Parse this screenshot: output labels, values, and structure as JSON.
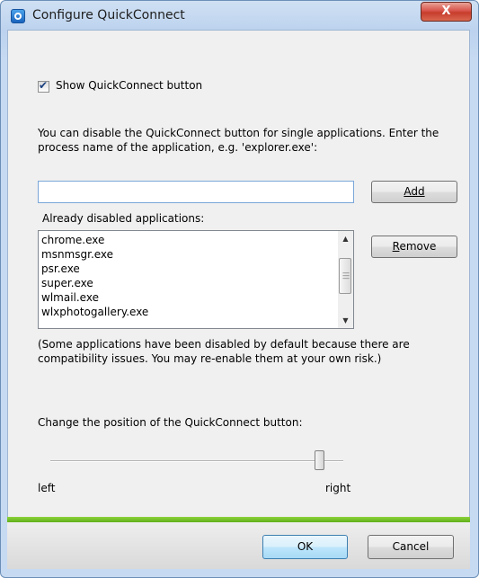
{
  "window": {
    "title": "Configure QuickConnect",
    "close_label": "X"
  },
  "show_checkbox": {
    "label": "Show QuickConnect button",
    "checked": true
  },
  "instruction": "You can disable the QuickConnect button for single applications. Enter the process name of the application, e.g. 'explorer.exe':",
  "process_input": {
    "value": "",
    "placeholder": ""
  },
  "buttons": {
    "add": "Add",
    "remove": "Remove",
    "ok": "OK",
    "cancel": "Cancel"
  },
  "list": {
    "label": "Already disabled applications:",
    "items": [
      "chrome.exe",
      "msnmsgr.exe",
      "psr.exe",
      "super.exe",
      "wlmail.exe",
      "wlxphotogallery.exe"
    ]
  },
  "note": "(Some applications have been disabled by default because there are compatibility issues. You may re-enable them at your own risk.)",
  "position": {
    "label": "Change the position of the QuickConnect button:",
    "left_label": "left",
    "right_label": "right",
    "value_fraction": 0.92
  },
  "colors": {
    "accent_green": "#6dbf28",
    "title_bar": "#c6daf2"
  }
}
